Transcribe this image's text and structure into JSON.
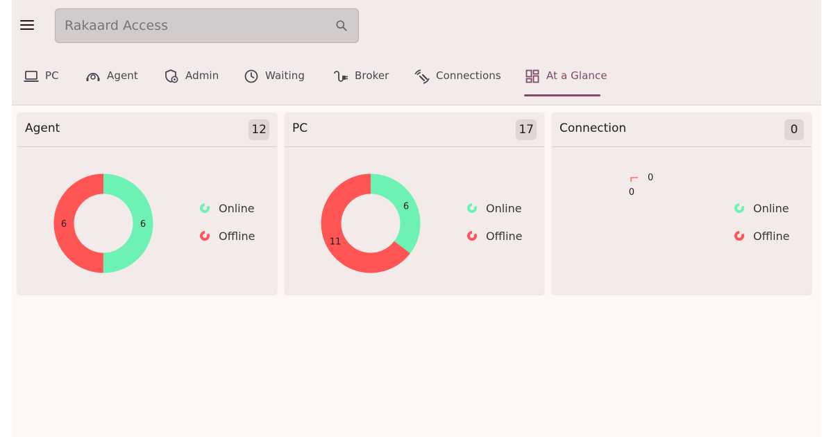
{
  "app": {
    "search_placeholder": "Rakaard Access"
  },
  "tabs": [
    {
      "label": "PC",
      "icon": "laptop-icon"
    },
    {
      "label": "Agent",
      "icon": "agent-icon"
    },
    {
      "label": "Admin",
      "icon": "admin-shield-icon"
    },
    {
      "label": "Waiting",
      "icon": "clock-icon"
    },
    {
      "label": "Broker",
      "icon": "plug-icon"
    },
    {
      "label": "Connections",
      "icon": "connections-icon"
    },
    {
      "label": "At a Glance",
      "icon": "dashboard-icon",
      "active": true
    }
  ],
  "colors": {
    "online": "#6ef2b3",
    "offline": "#ff5555",
    "accent": "#7d4a6a"
  },
  "cards": [
    {
      "title": "Agent",
      "count": "12"
    },
    {
      "title": "PC",
      "count": "17"
    },
    {
      "title": "Connection",
      "count": "0"
    }
  ],
  "legend": {
    "online": "Online",
    "offline": "Offline"
  },
  "chart_data": [
    {
      "type": "pie",
      "categories": [
        "Online",
        "Offline"
      ],
      "values": [
        6,
        6
      ],
      "labels": [
        "6",
        "6"
      ]
    },
    {
      "type": "pie",
      "categories": [
        "Online",
        "Offline"
      ],
      "values": [
        6,
        11
      ],
      "labels": [
        "6",
        "11"
      ]
    },
    {
      "type": "pie",
      "categories": [
        "Online",
        "Offline"
      ],
      "values": [
        0,
        0
      ],
      "labels": [
        "0",
        "0"
      ]
    }
  ]
}
